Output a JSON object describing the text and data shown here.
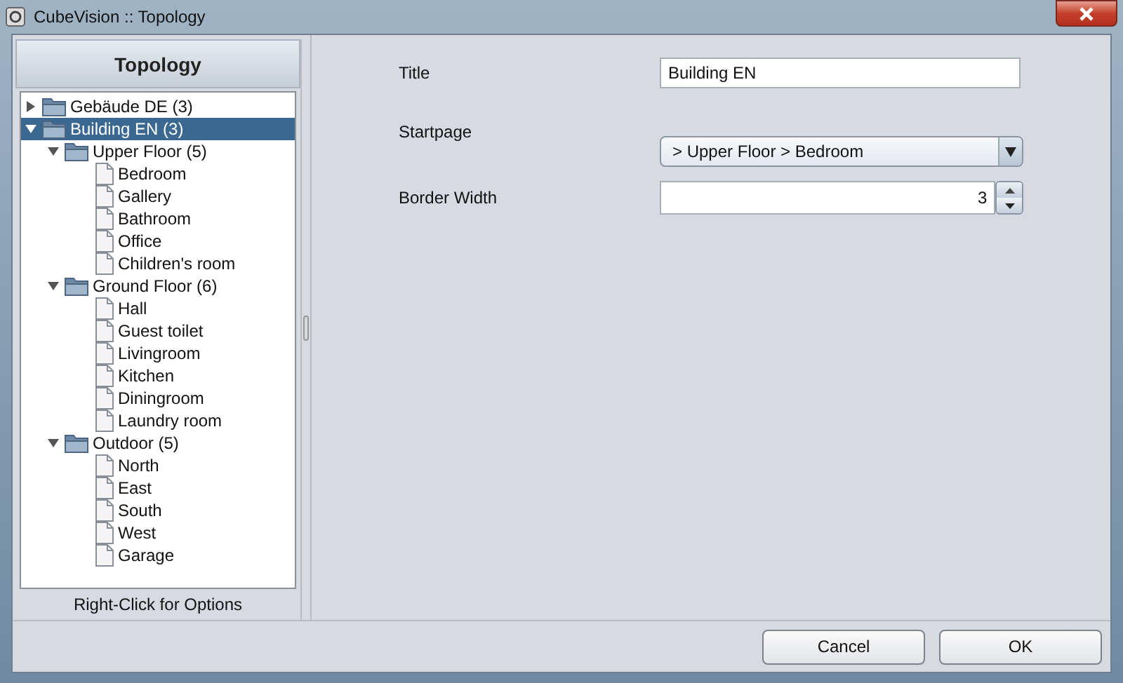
{
  "window": {
    "title": "CubeVision :: Topology"
  },
  "sidebar": {
    "title": "Topology",
    "footer": "Right-Click for Options",
    "tree": [
      {
        "label": "Gebäude DE (3)",
        "kind": "folder",
        "expanded": false,
        "selected": false
      },
      {
        "label": "Building EN (3)",
        "kind": "folder",
        "expanded": true,
        "selected": true,
        "children": [
          {
            "label": "Upper Floor (5)",
            "kind": "folder",
            "expanded": true,
            "selected": false,
            "children": [
              {
                "label": "Bedroom",
                "kind": "page",
                "selected": false
              },
              {
                "label": "Gallery",
                "kind": "page",
                "selected": false
              },
              {
                "label": "Bathroom",
                "kind": "page",
                "selected": false
              },
              {
                "label": "Office",
                "kind": "page",
                "selected": false
              },
              {
                "label": "Children's room",
                "kind": "page",
                "selected": false
              }
            ]
          },
          {
            "label": "Ground Floor (6)",
            "kind": "folder",
            "expanded": true,
            "selected": false,
            "children": [
              {
                "label": "Hall",
                "kind": "page",
                "selected": false
              },
              {
                "label": "Guest toilet",
                "kind": "page",
                "selected": false
              },
              {
                "label": "Livingroom",
                "kind": "page",
                "selected": false
              },
              {
                "label": "Kitchen",
                "kind": "page",
                "selected": false
              },
              {
                "label": "Diningroom",
                "kind": "page",
                "selected": false
              },
              {
                "label": "Laundry room",
                "kind": "page",
                "selected": false
              }
            ]
          },
          {
            "label": "Outdoor (5)",
            "kind": "folder",
            "expanded": true,
            "selected": false,
            "children": [
              {
                "label": "North",
                "kind": "page",
                "selected": false
              },
              {
                "label": "East",
                "kind": "page",
                "selected": false
              },
              {
                "label": "South",
                "kind": "page",
                "selected": false
              },
              {
                "label": "West",
                "kind": "page",
                "selected": false
              },
              {
                "label": "Garage",
                "kind": "page",
                "selected": false
              }
            ]
          }
        ]
      }
    ]
  },
  "form": [
    {
      "label": "Title",
      "kind": "text",
      "value": "Building EN"
    },
    {
      "label": "Startpage",
      "kind": "select",
      "value": "> Upper Floor > Bedroom"
    },
    {
      "label": "Border Width",
      "kind": "spinner",
      "value": "3"
    }
  ],
  "buttons": [
    "Cancel",
    "OK"
  ]
}
